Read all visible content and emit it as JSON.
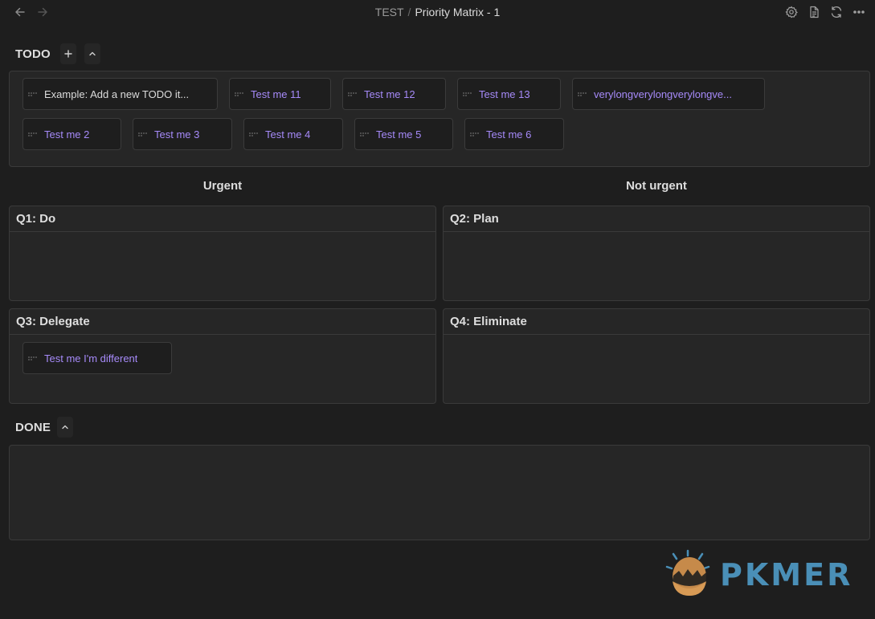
{
  "titlebar": {
    "parent": "TEST",
    "separator": "/",
    "current": "Priority Matrix - 1"
  },
  "todo": {
    "title": "TODO",
    "row1": [
      {
        "label": "Example: Add a new TODO it...",
        "style": "plain"
      },
      {
        "label": "Test me 11"
      },
      {
        "label": "Test me 12"
      },
      {
        "label": "Test me 13"
      },
      {
        "label": "verylongverylongverylongve..."
      }
    ],
    "row2": [
      {
        "label": "Test me 2"
      },
      {
        "label": "Test me 3"
      },
      {
        "label": "Test me 4"
      },
      {
        "label": "Test me 5"
      },
      {
        "label": "Test me 6"
      }
    ]
  },
  "columns": {
    "urgent": "Urgent",
    "not_urgent": "Not urgent"
  },
  "quadrants": {
    "q1": {
      "title": "Q1: Do"
    },
    "q2": {
      "title": "Q2: Plan"
    },
    "q3": {
      "title": "Q3: Delegate",
      "items": [
        {
          "label": "Test me I'm different"
        }
      ]
    },
    "q4": {
      "title": "Q4: Eliminate"
    }
  },
  "done": {
    "title": "DONE"
  },
  "watermark": {
    "text": "PKMER"
  },
  "colors": {
    "background": "#1e1e1e",
    "panel": "#262626",
    "accent": "#a68af9"
  }
}
